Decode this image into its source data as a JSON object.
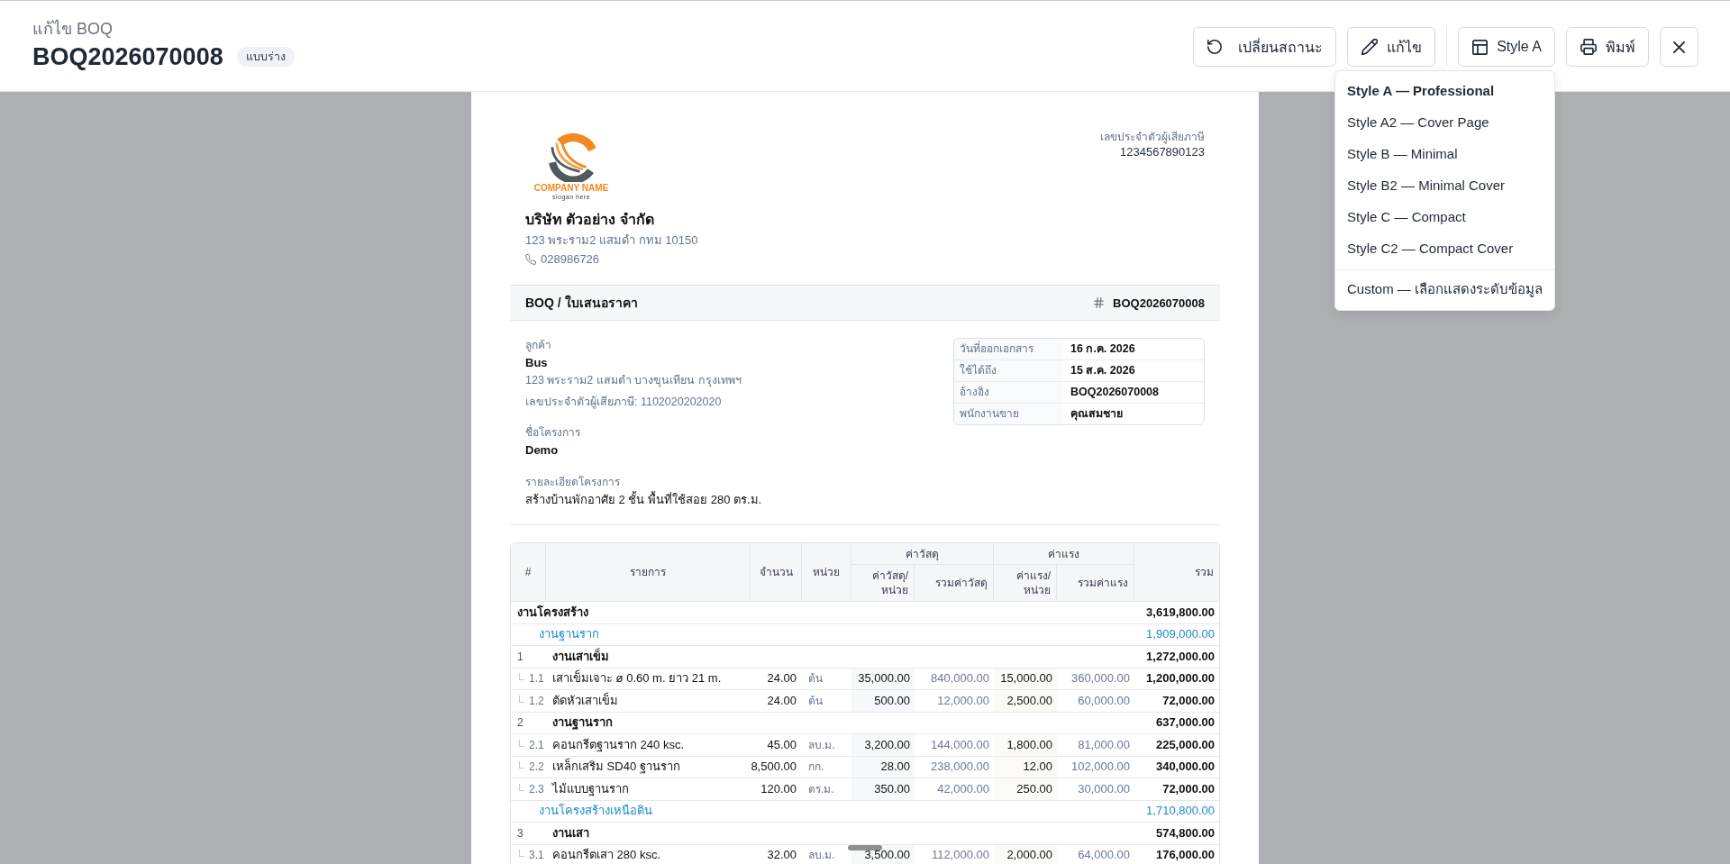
{
  "header": {
    "subtitle": "แก้ไข BOQ",
    "title": "BOQ2026070008",
    "status_badge": "แบบร่าง"
  },
  "toolbar": {
    "groups": [
      {
        "buttons": [
          {
            "kind": "status",
            "label": "เปลี่ยนสถานะ"
          },
          {
            "kind": "edit",
            "label": "แก้ไข"
          }
        ]
      },
      {
        "buttons": [
          {
            "kind": "style",
            "label": "Style A"
          },
          {
            "kind": "print",
            "label": "พิมพ์"
          },
          {
            "kind": "close"
          }
        ]
      }
    ]
  },
  "style_menu": {
    "open": true,
    "items": [
      {
        "kind": "style",
        "label": "Style A — Professional",
        "selected": true
      },
      {
        "kind": "style",
        "label": "Style A2 — Cover Page",
        "selected": false
      },
      {
        "kind": "style",
        "label": "Style B — Minimal",
        "selected": false
      },
      {
        "kind": "style",
        "label": "Style B2 — Minimal Cover",
        "selected": false
      },
      {
        "kind": "style",
        "label": "Style C — Compact",
        "selected": false
      },
      {
        "kind": "style",
        "label": "Style C2 — Compact Cover",
        "selected": false
      },
      {
        "kind": "custom",
        "label": "Custom — เลือกแสดงระดับข้อมูล",
        "selected": false
      }
    ]
  },
  "document": {
    "company": {
      "logo_name": "COMPANY NAME",
      "logo_slogan": "slogan here",
      "name": "บริษัท ตัวอย่าง จำกัด",
      "address": "123 พระราม2 แสมดำ กทม 10150",
      "phone": "028986726"
    },
    "tax_id": {
      "label": "เลขประจำตัวผู้เสียภาษี",
      "value": "1234567890123"
    },
    "doc_bar": {
      "title": "BOQ / ใบเสนอราคา",
      "number": "BOQ2026070008"
    },
    "customer": {
      "label": "ลูกค้า",
      "name": "Bus",
      "address": "123 พระราม2 แสมดำ บางขุนเทียน กรุงเทพฯ",
      "tax_id": "เลขประจำตัวผู้เสียภาษี: 1102020202020"
    },
    "project": {
      "name_label": "ชื่อโครงการ",
      "name": "Demo",
      "detail_label": "รายละเอียดโครงการ",
      "detail": "สร้างบ้านพักอาศัย 2 ชั้น พื้นที่ใช้สอย 280 ตร.ม."
    },
    "info": [
      {
        "label": "วันที่ออกเอกสาร",
        "value": "16 ก.ค. 2026"
      },
      {
        "label": "ใช้ได้ถึง",
        "value": "15 ส.ค. 2026"
      },
      {
        "label": "อ้างอิง",
        "value": "BOQ2026070008"
      },
      {
        "label": "พนักงานขาย",
        "value": "คุณสมชาย"
      }
    ],
    "table": {
      "columns": [
        {
          "label": "#"
        },
        {
          "label": "รายการ"
        },
        {
          "label": "จำนวน"
        },
        {
          "label": "หน่วย"
        },
        {
          "label": "ค่าวัสดุ",
          "children": [
            {
              "label": "ค่าวัสดุ/หน่วย"
            },
            {
              "label": "รวมค่าวัสดุ"
            }
          ]
        },
        {
          "label": "ค่าแรง",
          "children": [
            {
              "label": "ค่าแรง/หน่วย"
            },
            {
              "label": "รวมค่าแรง"
            }
          ]
        },
        {
          "label": "รวม"
        }
      ],
      "rows": [
        {
          "kind": "category",
          "description": "งานโครงสร้าง",
          "total": "3,619,800.00"
        },
        {
          "kind": "subcategory",
          "description": "งานฐานราก",
          "total": "1,909,000.00"
        },
        {
          "kind": "group",
          "no": "1",
          "description": "งานเสาเข็ม",
          "total": "1,272,000.00"
        },
        {
          "kind": "item",
          "no": "1.1",
          "description": "เสาเข็มเจาะ ø 0.60 m. ยาว 21 m.",
          "qty": "24.00",
          "unit": "ต้น",
          "material_unit_price": "35,000.00",
          "material_total": "840,000.00",
          "labor_unit_price": "15,000.00",
          "labor_total": "360,000.00",
          "total": "1,200,000.00"
        },
        {
          "kind": "item",
          "no": "1.2",
          "description": "ตัดหัวเสาเข็ม",
          "qty": "24.00",
          "unit": "ต้น",
          "material_unit_price": "500.00",
          "material_total": "12,000.00",
          "labor_unit_price": "2,500.00",
          "labor_total": "60,000.00",
          "total": "72,000.00"
        },
        {
          "kind": "group",
          "no": "2",
          "description": "งานฐานราก",
          "total": "637,000.00"
        },
        {
          "kind": "item",
          "no": "2.1",
          "description": "คอนกรีตฐานราก 240 ksc.",
          "qty": "45.00",
          "unit": "ลบ.ม.",
          "material_unit_price": "3,200.00",
          "material_total": "144,000.00",
          "labor_unit_price": "1,800.00",
          "labor_total": "81,000.00",
          "total": "225,000.00"
        },
        {
          "kind": "item",
          "no": "2.2",
          "description": "เหล็กเสริม SD40 ฐานราก",
          "qty": "8,500.00",
          "unit": "กก.",
          "material_unit_price": "28.00",
          "material_total": "238,000.00",
          "labor_unit_price": "12.00",
          "labor_total": "102,000.00",
          "total": "340,000.00"
        },
        {
          "kind": "item",
          "no": "2.3",
          "description": "ไม้แบบฐานราก",
          "qty": "120.00",
          "unit": "ตร.ม.",
          "material_unit_price": "350.00",
          "material_total": "42,000.00",
          "labor_unit_price": "250.00",
          "labor_total": "30,000.00",
          "total": "72,000.00"
        },
        {
          "kind": "subcategory",
          "description": "งานโครงสร้างเหนือดิน",
          "total": "1,710,800.00"
        },
        {
          "kind": "group",
          "no": "3",
          "description": "งานเสา",
          "total": "574,800.00"
        },
        {
          "kind": "item",
          "no": "3.1",
          "description": "คอนกรีตเสา 280 ksc.",
          "qty": "32.00",
          "unit": "ลบ.ม.",
          "material_unit_price": "3,500.00",
          "material_total": "112,000.00",
          "labor_unit_price": "2,000.00",
          "labor_total": "64,000.00",
          "total": "176,000.00"
        }
      ]
    }
  }
}
